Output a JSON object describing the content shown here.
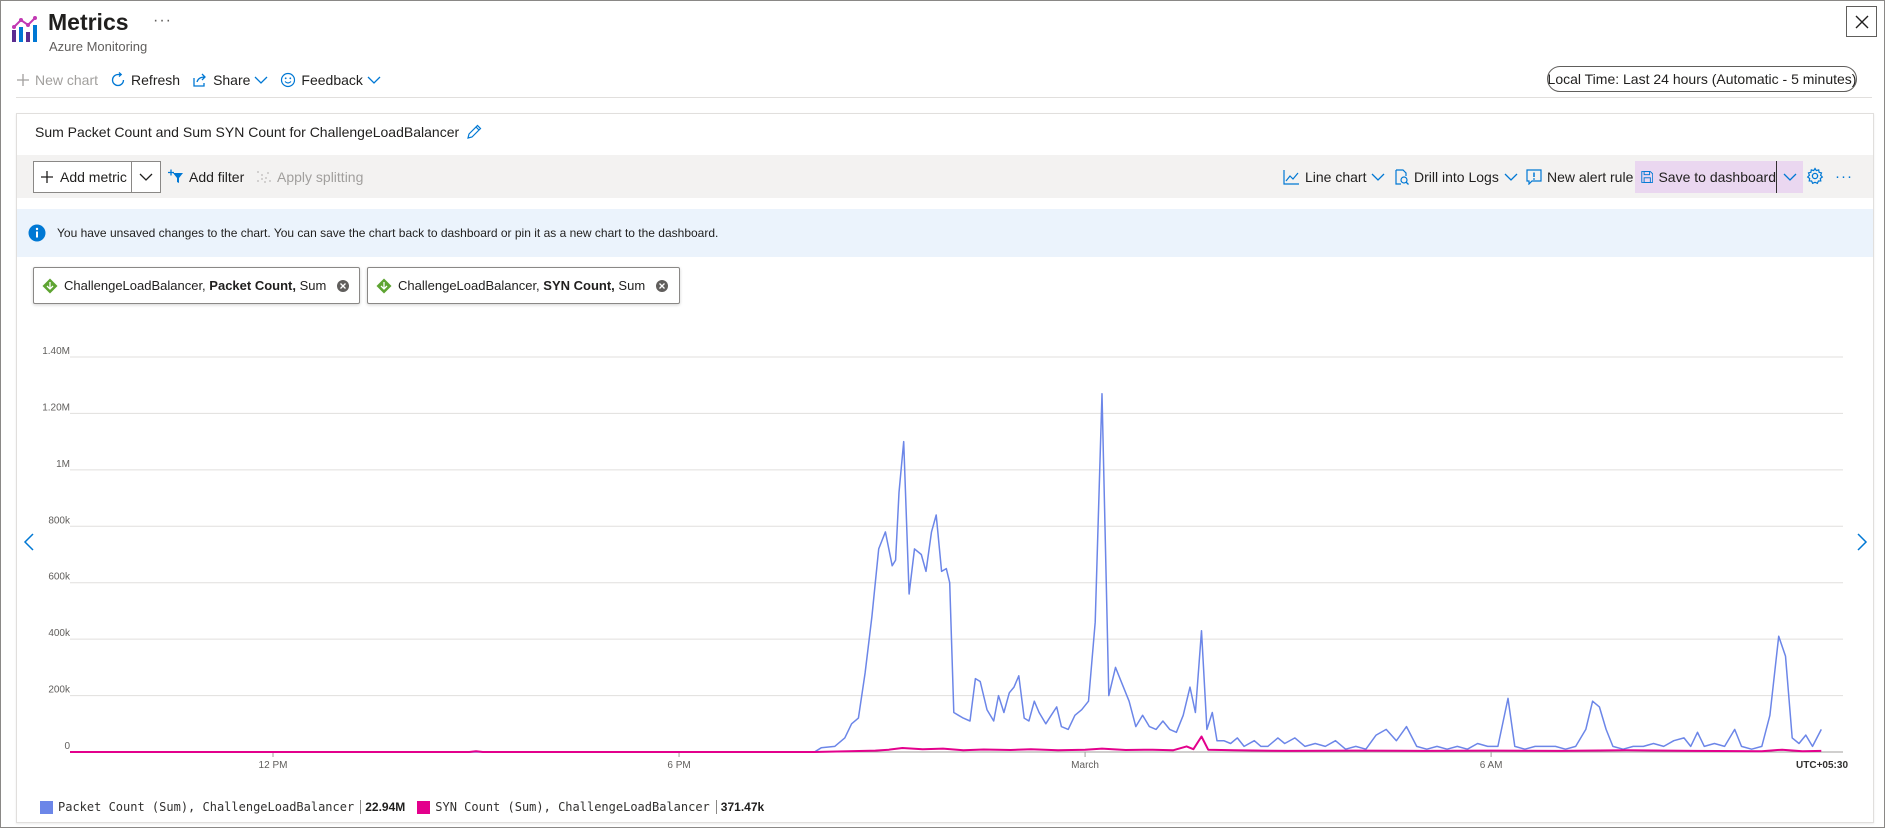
{
  "header": {
    "title": "Metrics",
    "subtitle": "Azure Monitoring",
    "more_label": "···"
  },
  "commands": {
    "new_chart": "New chart",
    "refresh": "Refresh",
    "share": "Share",
    "feedback": "Feedback"
  },
  "time_range": "Local Time: Last 24 hours (Automatic - 5 minutes)",
  "chart_card": {
    "title": "Sum Packet Count and Sum SYN Count for ChallengeLoadBalancer",
    "toolbar": {
      "add_metric": "Add metric",
      "add_filter": "Add filter",
      "apply_splitting": "Apply splitting",
      "line_chart": "Line chart",
      "drill_into_logs": "Drill into Logs",
      "new_alert_rule": "New alert rule",
      "save_to_dashboard": "Save to dashboard",
      "more_label": "···"
    },
    "info_message": "You have unsaved changes to the chart. You can save the chart back to dashboard or pin it as a new chart to the dashboard.",
    "pills": [
      {
        "resource": "ChallengeLoadBalancer,",
        "metric": "Packet Count,",
        "aggregation": "Sum"
      },
      {
        "resource": "ChallengeLoadBalancer,",
        "metric": "SYN Count,",
        "aggregation": "Sum"
      }
    ]
  },
  "chart_data": {
    "type": "line",
    "x_tick_labels": [
      "12 PM",
      "6 PM",
      "March",
      "6 AM"
    ],
    "y_tick_labels": [
      "0",
      "200k",
      "400k",
      "600k",
      "800k",
      "1M",
      "1.20M",
      "1.40M"
    ],
    "y_ticks": [
      0,
      200000,
      400000,
      600000,
      800000,
      1000000,
      1200000,
      1400000
    ],
    "ylim": [
      0,
      1400000
    ],
    "timezone_label": "UTC+05:30",
    "grid": true,
    "legend_position": "bottom-left",
    "x_start_hour": 9,
    "x_end_hour": 35.2,
    "x_tick_hours": [
      12,
      18,
      24,
      30
    ],
    "series": [
      {
        "name": "Packet Count (Sum), ChallengeLoadBalancer",
        "total": "22.94M",
        "color": "#6c86e8",
        "points": [
          [
            9.0,
            0
          ],
          [
            20.0,
            0
          ],
          [
            20.1,
            15000
          ],
          [
            20.3,
            20000
          ],
          [
            20.45,
            50000
          ],
          [
            20.55,
            100000
          ],
          [
            20.65,
            120000
          ],
          [
            20.75,
            280000
          ],
          [
            20.85,
            480000
          ],
          [
            20.95,
            720000
          ],
          [
            21.05,
            780000
          ],
          [
            21.15,
            660000
          ],
          [
            21.2,
            680000
          ],
          [
            21.25,
            920000
          ],
          [
            21.32,
            1100000
          ],
          [
            21.4,
            560000
          ],
          [
            21.48,
            720000
          ],
          [
            21.58,
            700000
          ],
          [
            21.65,
            640000
          ],
          [
            21.73,
            780000
          ],
          [
            21.8,
            840000
          ],
          [
            21.88,
            640000
          ],
          [
            21.95,
            650000
          ],
          [
            22.0,
            600000
          ],
          [
            22.06,
            140000
          ],
          [
            22.13,
            130000
          ],
          [
            22.2,
            120000
          ],
          [
            22.3,
            110000
          ],
          [
            22.38,
            260000
          ],
          [
            22.45,
            250000
          ],
          [
            22.55,
            150000
          ],
          [
            22.65,
            110000
          ],
          [
            22.72,
            200000
          ],
          [
            22.8,
            140000
          ],
          [
            22.88,
            210000
          ],
          [
            22.95,
            230000
          ],
          [
            23.02,
            270000
          ],
          [
            23.1,
            120000
          ],
          [
            23.17,
            110000
          ],
          [
            23.25,
            180000
          ],
          [
            23.32,
            140000
          ],
          [
            23.42,
            100000
          ],
          [
            23.5,
            130000
          ],
          [
            23.58,
            160000
          ],
          [
            23.65,
            90000
          ],
          [
            23.75,
            80000
          ],
          [
            23.85,
            130000
          ],
          [
            23.95,
            150000
          ],
          [
            24.05,
            180000
          ],
          [
            24.15,
            460000
          ],
          [
            24.25,
            1270000
          ],
          [
            24.35,
            200000
          ],
          [
            24.45,
            300000
          ],
          [
            24.55,
            240000
          ],
          [
            24.65,
            180000
          ],
          [
            24.75,
            90000
          ],
          [
            24.85,
            130000
          ],
          [
            24.95,
            90000
          ],
          [
            25.05,
            80000
          ],
          [
            25.15,
            110000
          ],
          [
            25.25,
            80000
          ],
          [
            25.35,
            70000
          ],
          [
            25.45,
            130000
          ],
          [
            25.55,
            230000
          ],
          [
            25.63,
            140000
          ],
          [
            25.72,
            430000
          ],
          [
            25.8,
            80000
          ],
          [
            25.88,
            140000
          ],
          [
            25.95,
            40000
          ],
          [
            26.05,
            40000
          ],
          [
            26.15,
            30000
          ],
          [
            26.25,
            50000
          ],
          [
            26.35,
            20000
          ],
          [
            26.5,
            40000
          ],
          [
            26.6,
            20000
          ],
          [
            26.7,
            20000
          ],
          [
            26.85,
            50000
          ],
          [
            26.95,
            30000
          ],
          [
            27.1,
            50000
          ],
          [
            27.25,
            20000
          ],
          [
            27.4,
            30000
          ],
          [
            27.55,
            20000
          ],
          [
            27.7,
            40000
          ],
          [
            27.85,
            10000
          ],
          [
            28.0,
            20000
          ],
          [
            28.15,
            10000
          ],
          [
            28.3,
            60000
          ],
          [
            28.45,
            80000
          ],
          [
            28.6,
            40000
          ],
          [
            28.75,
            90000
          ],
          [
            28.9,
            20000
          ],
          [
            29.05,
            10000
          ],
          [
            29.2,
            20000
          ],
          [
            29.35,
            10000
          ],
          [
            29.5,
            20000
          ],
          [
            29.65,
            10000
          ],
          [
            29.8,
            30000
          ],
          [
            29.95,
            20000
          ],
          [
            30.1,
            20000
          ],
          [
            30.25,
            190000
          ],
          [
            30.35,
            20000
          ],
          [
            30.5,
            10000
          ],
          [
            30.65,
            20000
          ],
          [
            30.8,
            20000
          ],
          [
            30.95,
            20000
          ],
          [
            31.1,
            10000
          ],
          [
            31.25,
            20000
          ],
          [
            31.4,
            80000
          ],
          [
            31.5,
            180000
          ],
          [
            31.6,
            160000
          ],
          [
            31.7,
            80000
          ],
          [
            31.8,
            20000
          ],
          [
            31.95,
            10000
          ],
          [
            32.1,
            20000
          ],
          [
            32.25,
            20000
          ],
          [
            32.4,
            30000
          ],
          [
            32.55,
            20000
          ],
          [
            32.7,
            40000
          ],
          [
            32.85,
            50000
          ],
          [
            32.95,
            20000
          ],
          [
            33.05,
            70000
          ],
          [
            33.15,
            20000
          ],
          [
            33.3,
            30000
          ],
          [
            33.45,
            20000
          ],
          [
            33.6,
            80000
          ],
          [
            33.7,
            20000
          ],
          [
            33.85,
            10000
          ],
          [
            34.0,
            20000
          ],
          [
            34.12,
            130000
          ],
          [
            34.25,
            410000
          ],
          [
            34.35,
            340000
          ],
          [
            34.45,
            50000
          ],
          [
            34.55,
            30000
          ],
          [
            34.65,
            60000
          ],
          [
            34.75,
            20000
          ],
          [
            34.88,
            80000
          ]
        ]
      },
      {
        "name": "SYN Count (Sum), ChallengeLoadBalancer",
        "total": "371.47k",
        "color": "#e3008c",
        "points": [
          [
            9.0,
            0
          ],
          [
            14.9,
            0
          ],
          [
            15.0,
            3000
          ],
          [
            15.1,
            0
          ],
          [
            20.0,
            0
          ],
          [
            20.5,
            3000
          ],
          [
            20.9,
            5000
          ],
          [
            21.1,
            8000
          ],
          [
            21.3,
            14000
          ],
          [
            21.6,
            10000
          ],
          [
            21.9,
            12000
          ],
          [
            22.2,
            6000
          ],
          [
            22.5,
            9000
          ],
          [
            22.9,
            7000
          ],
          [
            23.2,
            10000
          ],
          [
            23.6,
            6000
          ],
          [
            24.0,
            8000
          ],
          [
            24.25,
            12000
          ],
          [
            24.6,
            7000
          ],
          [
            25.0,
            8000
          ],
          [
            25.3,
            6000
          ],
          [
            25.5,
            20000
          ],
          [
            25.6,
            10000
          ],
          [
            25.72,
            55000
          ],
          [
            25.82,
            8000
          ],
          [
            26.2,
            6000
          ],
          [
            27.0,
            4000
          ],
          [
            28.0,
            5000
          ],
          [
            29.0,
            4000
          ],
          [
            30.0,
            5000
          ],
          [
            31.0,
            4000
          ],
          [
            32.0,
            6000
          ],
          [
            33.0,
            4000
          ],
          [
            34.0,
            3000
          ],
          [
            34.3,
            8000
          ],
          [
            34.6,
            3000
          ],
          [
            34.88,
            4000
          ]
        ]
      }
    ]
  }
}
